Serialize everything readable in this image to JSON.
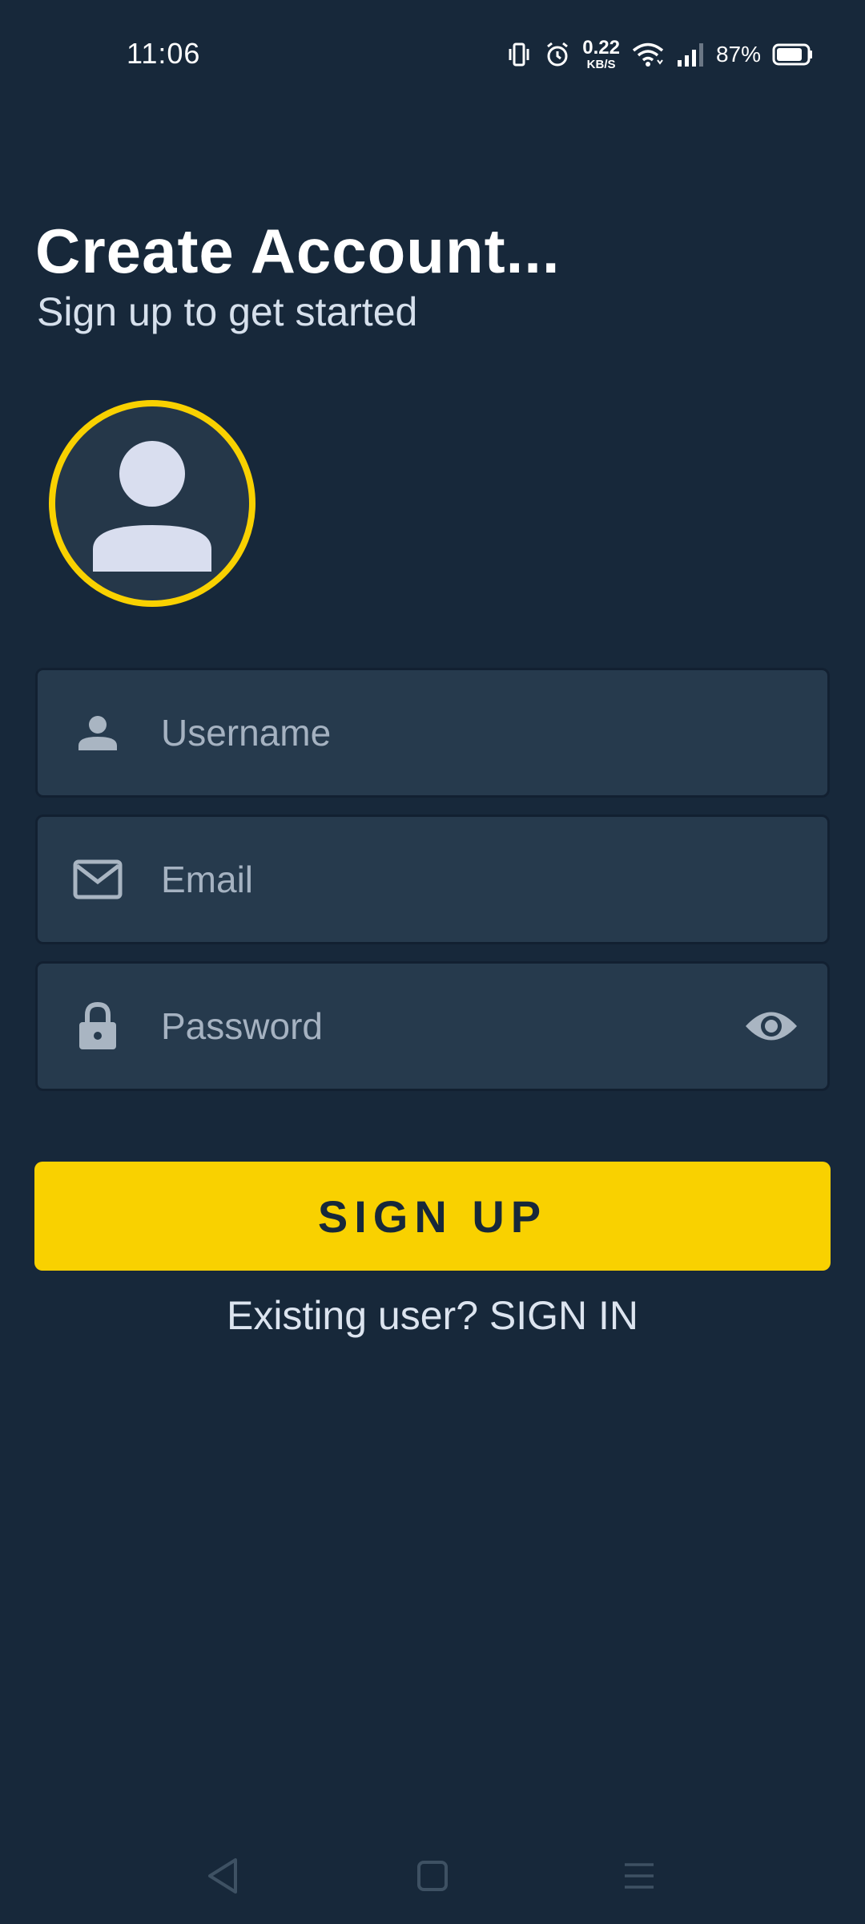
{
  "status_bar": {
    "time": "11:06",
    "net_speed_value": "0.22",
    "net_speed_unit": "KB/S",
    "battery_percent": "87%",
    "battery_level": 0.87,
    "icons": [
      "vibrate-icon",
      "alarm-icon",
      "wifi-icon",
      "signal-icon",
      "battery-icon"
    ]
  },
  "header": {
    "title": "Create Account...",
    "subtitle": "Sign up to get started"
  },
  "avatar": {
    "icon": "person-avatar-icon"
  },
  "form": {
    "username": {
      "value": "",
      "placeholder": "Username",
      "icon": "person-icon"
    },
    "email": {
      "value": "",
      "placeholder": "Email",
      "icon": "mail-icon"
    },
    "password": {
      "value": "",
      "placeholder": "Password",
      "icon": "lock-icon",
      "toggle_icon": "eye-icon"
    }
  },
  "actions": {
    "signup_label": "SIGN UP",
    "signin_text": "Existing user? SIGN IN"
  },
  "nav_bar": {
    "icons": [
      "back-icon",
      "home-icon",
      "menu-icon"
    ]
  },
  "colors": {
    "background": "#17283a",
    "field_background": "#263a4d",
    "accent": "#f9d100",
    "text_primary": "#ffffff",
    "placeholder": "#a5b2c1",
    "icon": "#a9b5c2"
  }
}
